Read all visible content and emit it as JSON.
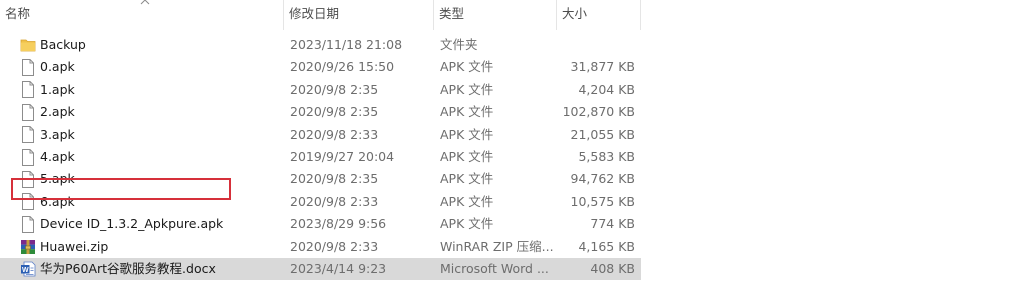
{
  "columns": {
    "name": "名称",
    "date": "修改日期",
    "type": "类型",
    "size": "大小"
  },
  "files": [
    {
      "name": "Backup",
      "date": "2023/11/18 21:08",
      "type": "文件夹",
      "size": "",
      "icon": "folder-icon"
    },
    {
      "name": "0.apk",
      "date": "2020/9/26 15:50",
      "type": "APK 文件",
      "size": "31,877 KB",
      "icon": "file-icon"
    },
    {
      "name": "1.apk",
      "date": "2020/9/8 2:35",
      "type": "APK 文件",
      "size": "4,204 KB",
      "icon": "file-icon"
    },
    {
      "name": "2.apk",
      "date": "2020/9/8 2:35",
      "type": "APK 文件",
      "size": "102,870 KB",
      "icon": "file-icon"
    },
    {
      "name": "3.apk",
      "date": "2020/9/8 2:33",
      "type": "APK 文件",
      "size": "21,055 KB",
      "icon": "file-icon"
    },
    {
      "name": "4.apk",
      "date": "2019/9/27 20:04",
      "type": "APK 文件",
      "size": "5,583 KB",
      "icon": "file-icon"
    },
    {
      "name": "5.apk",
      "date": "2020/9/8 2:35",
      "type": "APK 文件",
      "size": "94,762 KB",
      "icon": "file-icon"
    },
    {
      "name": "6.apk",
      "date": "2020/9/8 2:33",
      "type": "APK 文件",
      "size": "10,575 KB",
      "icon": "file-icon"
    },
    {
      "name": "Device ID_1.3.2_Apkpure.apk",
      "date": "2023/8/29 9:56",
      "type": "APK 文件",
      "size": "774 KB",
      "icon": "file-icon",
      "highlighted": true
    },
    {
      "name": "Huawei.zip",
      "date": "2020/9/8 2:33",
      "type": "WinRAR ZIP 压缩...",
      "size": "4,165 KB",
      "icon": "winrar-archive-icon"
    },
    {
      "name": "华为P60Art谷歌服务教程.docx",
      "date": "2023/4/14 9:23",
      "type": "Microsoft Word ...",
      "size": "408 KB",
      "icon": "word-document-icon",
      "selected": true
    }
  ],
  "colors": {
    "highlight_border": "#d6303a",
    "selected_row": "#d9d9d9",
    "folder": "#e8b23a"
  }
}
